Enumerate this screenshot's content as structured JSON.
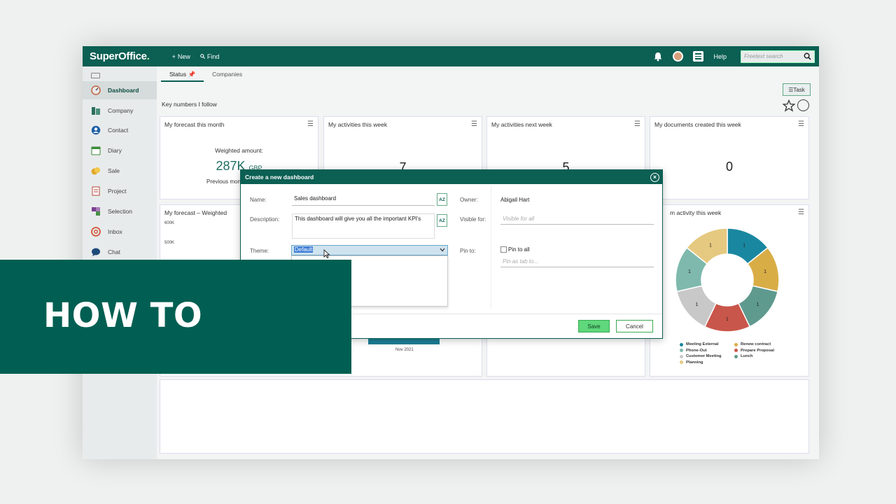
{
  "topbar": {
    "logo": "SuperOffice",
    "new_label": "New",
    "find_label": "Find",
    "help_label": "Help",
    "search_placeholder": "Freetext search"
  },
  "sidebar": {
    "items": [
      {
        "label": "Dashboard",
        "icon": "dashboard-icon"
      },
      {
        "label": "Company",
        "icon": "company-icon"
      },
      {
        "label": "Contact",
        "icon": "contact-icon"
      },
      {
        "label": "Diary",
        "icon": "diary-icon"
      },
      {
        "label": "Sale",
        "icon": "sale-icon"
      },
      {
        "label": "Project",
        "icon": "project-icon"
      },
      {
        "label": "Selection",
        "icon": "selection-icon"
      },
      {
        "label": "Inbox",
        "icon": "inbox-icon"
      },
      {
        "label": "Chat",
        "icon": "chat-icon"
      }
    ]
  },
  "main": {
    "tabs": [
      "Status",
      "Companies"
    ],
    "task_label": "Task",
    "key_numbers": "Key numbers I follow",
    "cards": {
      "forecast": {
        "title": "My forecast this month",
        "weighted_label": "Weighted amount:",
        "value": "287K",
        "currency": "GBP",
        "previous": "Previous month"
      },
      "activities_this_week": {
        "title": "My activities this week",
        "value": "7"
      },
      "activities_next_week": {
        "title": "My activities next week",
        "value": "5"
      },
      "documents": {
        "title": "My documents created this week",
        "value": "0"
      },
      "forecast_weighted": {
        "title": "My forecast – Weighted",
        "y_ticks": [
          "600K",
          "500K"
        ],
        "x_label": "Nov 2021"
      },
      "team_activity": {
        "title": "m activity this week"
      }
    }
  },
  "dialog": {
    "title": "Create a new dashboard",
    "name_label": "Name:",
    "name_value": "Sales dashboard",
    "description_label": "Description:",
    "description_value": "This dashboard will give you all the important KPI's",
    "theme_label": "Theme:",
    "theme_value": "Default",
    "owner_label": "Owner:",
    "owner_value": "Abigail Hart",
    "visible_label": "Visible for:",
    "visible_placeholder": "Visible for all",
    "pin_label": "Pin to:",
    "pin_all_label": "Pin to all",
    "pin_placeholder": "Pin as tab to...",
    "az_label": "AZ",
    "save_label": "Save",
    "cancel_label": "Cancel"
  },
  "chart_data": {
    "type": "pie",
    "title": "",
    "categories": [
      "Meeting External",
      "Renew contract",
      "Lunch",
      "Prepare Proposal",
      "Customer Meeting",
      "Phone-Out",
      "Planning"
    ],
    "values": [
      1,
      1,
      1,
      1,
      1,
      1,
      1
    ],
    "colors": [
      "#1a87a0",
      "#d9ad46",
      "#5f9a8e",
      "#c9564a",
      "#c8c8c8",
      "#7fb9ad",
      "#e6c980"
    ],
    "legend_position": "bottom"
  },
  "banner": {
    "text": "HOW TO"
  }
}
